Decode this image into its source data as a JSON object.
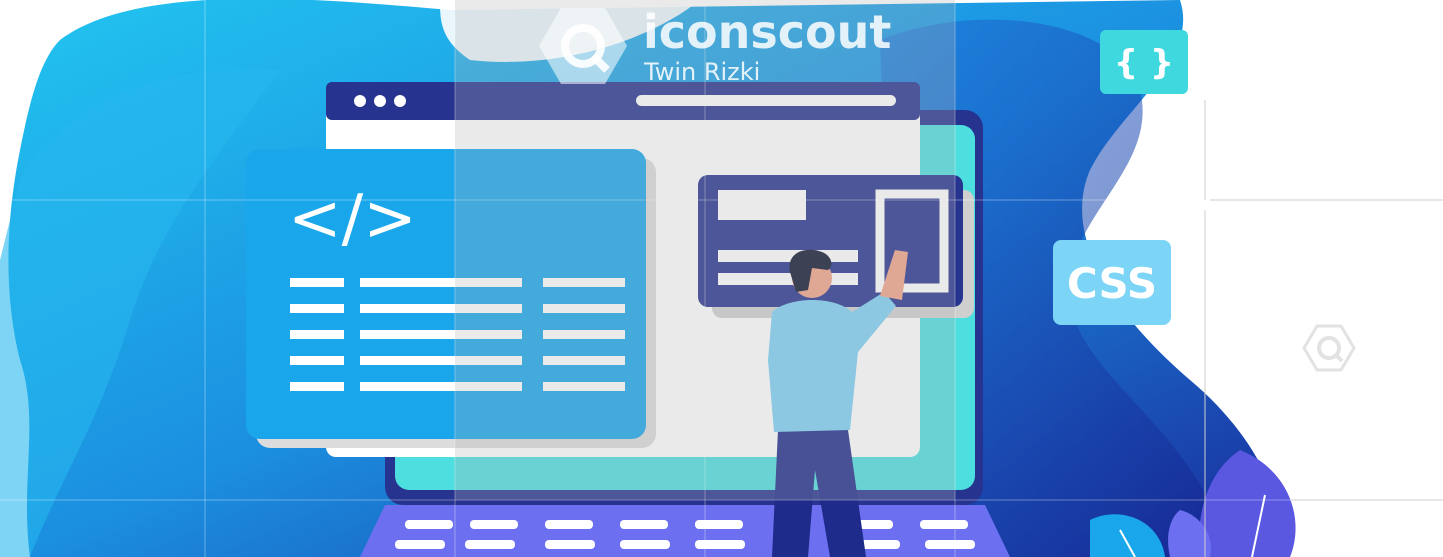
{
  "watermark": {
    "brand": "iconscout",
    "author": "Twin Rizki"
  },
  "illustration": {
    "code_symbol": "</>",
    "braces_badge": "{ }",
    "css_badge": "CSS"
  },
  "colors": {
    "blob_light": "#22c5f0",
    "blob_mid": "#1b8fe0",
    "blob_dark": "#1a2a9c",
    "navy": "#26338f",
    "code_panel": "#1aa6ea",
    "teal": "#4ddfe0",
    "keyboard": "#6c6ff0",
    "badge_teal": "#3fd8df",
    "badge_blue": "#7cd4f7",
    "shirt": "#7dd0f4",
    "pants": "#1f2b8a",
    "hair": "#0e1530",
    "skin": "#f0a48a"
  }
}
